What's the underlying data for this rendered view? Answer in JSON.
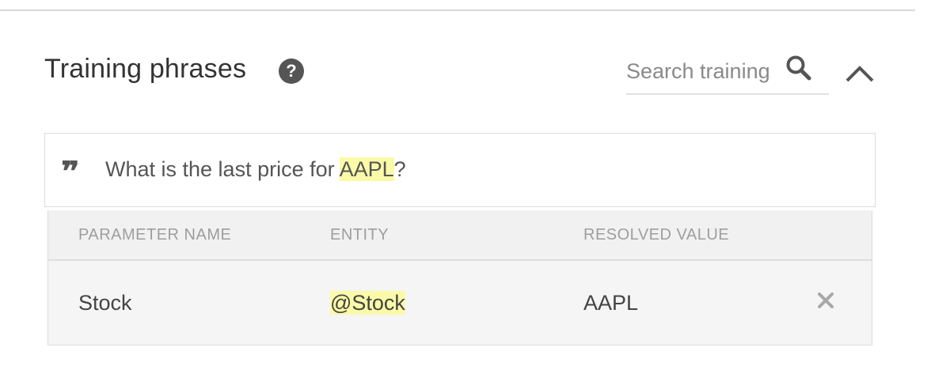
{
  "section": {
    "title": "Training phrases",
    "help_icon": "help-circle-icon"
  },
  "search": {
    "placeholder": "Search training",
    "value": "",
    "icon": "search-icon"
  },
  "collapse_icon": "chevron-up-icon",
  "phrase": {
    "icon": "quote-icon",
    "quote_glyph": "❞",
    "text_before": "What is the last price for ",
    "highlight": "AAPL",
    "text_after": "?"
  },
  "parameters": {
    "headers": [
      "PARAMETER NAME",
      "ENTITY",
      "RESOLVED VALUE"
    ],
    "rows": [
      {
        "name": "Stock",
        "entity": "@Stock",
        "resolved_value": "AAPL",
        "remove_icon": "close-icon"
      }
    ]
  },
  "colors": {
    "highlight": "#fbfaa8",
    "text": "#333333",
    "muted": "#9e9e9e"
  }
}
